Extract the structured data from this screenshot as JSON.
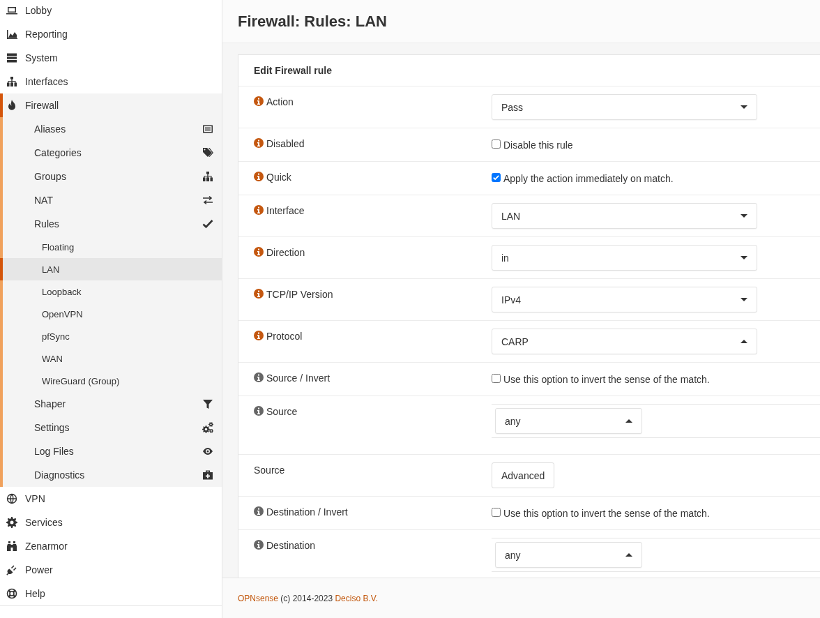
{
  "sidebar": {
    "items": [
      {
        "label": "Lobby",
        "selected": false
      },
      {
        "label": "Reporting",
        "selected": false
      },
      {
        "label": "System",
        "selected": false
      },
      {
        "label": "Interfaces",
        "selected": false
      },
      {
        "label": "Firewall",
        "selected": true,
        "children": [
          {
            "label": "Aliases",
            "selected": false
          },
          {
            "label": "Categories",
            "selected": false
          },
          {
            "label": "Groups",
            "selected": false
          },
          {
            "label": "NAT",
            "selected": false
          },
          {
            "label": "Rules",
            "selected": false,
            "children": [
              {
                "label": "Floating",
                "selected": false
              },
              {
                "label": "LAN",
                "selected": true
              },
              {
                "label": "Loopback",
                "selected": false
              },
              {
                "label": "OpenVPN",
                "selected": false
              },
              {
                "label": "pfSync",
                "selected": false
              },
              {
                "label": "WAN",
                "selected": false
              },
              {
                "label": "WireGuard (Group)",
                "selected": false
              }
            ]
          },
          {
            "label": "Shaper",
            "selected": false
          },
          {
            "label": "Settings",
            "selected": false
          },
          {
            "label": "Log Files",
            "selected": false
          },
          {
            "label": "Diagnostics",
            "selected": false
          }
        ]
      },
      {
        "label": "VPN",
        "selected": false
      },
      {
        "label": "Services",
        "selected": false
      },
      {
        "label": "Zenarmor",
        "selected": false
      },
      {
        "label": "Power",
        "selected": false
      },
      {
        "label": "Help",
        "selected": false
      }
    ]
  },
  "page_title": "Firewall: Rules: LAN",
  "form": {
    "title": "Edit Firewall rule",
    "rows": [
      {
        "kind": "select",
        "label": "Action",
        "color": "#c4570f",
        "value": "Pass",
        "caret_up": false
      },
      {
        "kind": "checkbox",
        "label": "Disabled",
        "color": "#c4570f",
        "checked": false,
        "text": "Disable this rule"
      },
      {
        "kind": "checkbox",
        "label": "Quick",
        "color": "#c4570f",
        "checked": true,
        "text": "Apply the action immediately on match."
      },
      {
        "kind": "select",
        "label": "Interface",
        "color": "#c4570f",
        "value": "LAN",
        "caret_up": false
      },
      {
        "kind": "select",
        "label": "Direction",
        "color": "#c4570f",
        "value": "in",
        "caret_up": false
      },
      {
        "kind": "select",
        "label": "TCP/IP Version",
        "color": "#c4570f",
        "value": "IPv4",
        "caret_up": false
      },
      {
        "kind": "select",
        "label": "Protocol",
        "color": "#c4570f",
        "value": "CARP",
        "caret_up": true
      },
      {
        "kind": "checkbox",
        "label": "Source / Invert",
        "color": "#666666",
        "checked": false,
        "text": "Use this option to invert the sense of the match."
      },
      {
        "kind": "address",
        "label": "Source",
        "color": "#666666",
        "value": "any",
        "caret_up": true
      },
      {
        "kind": "button",
        "label": "Source",
        "button": "Advanced"
      },
      {
        "kind": "checkbox",
        "label": "Destination / Invert",
        "color": "#666666",
        "checked": false,
        "text": "Use this option to invert the sense of the match."
      },
      {
        "kind": "address",
        "label": "Destination",
        "color": "#666666",
        "value": "any",
        "caret_up": true
      }
    ]
  },
  "footer": {
    "brand": "OPNsense",
    "copyright": "(c) 2014-2023",
    "company": "Deciso B.V."
  }
}
